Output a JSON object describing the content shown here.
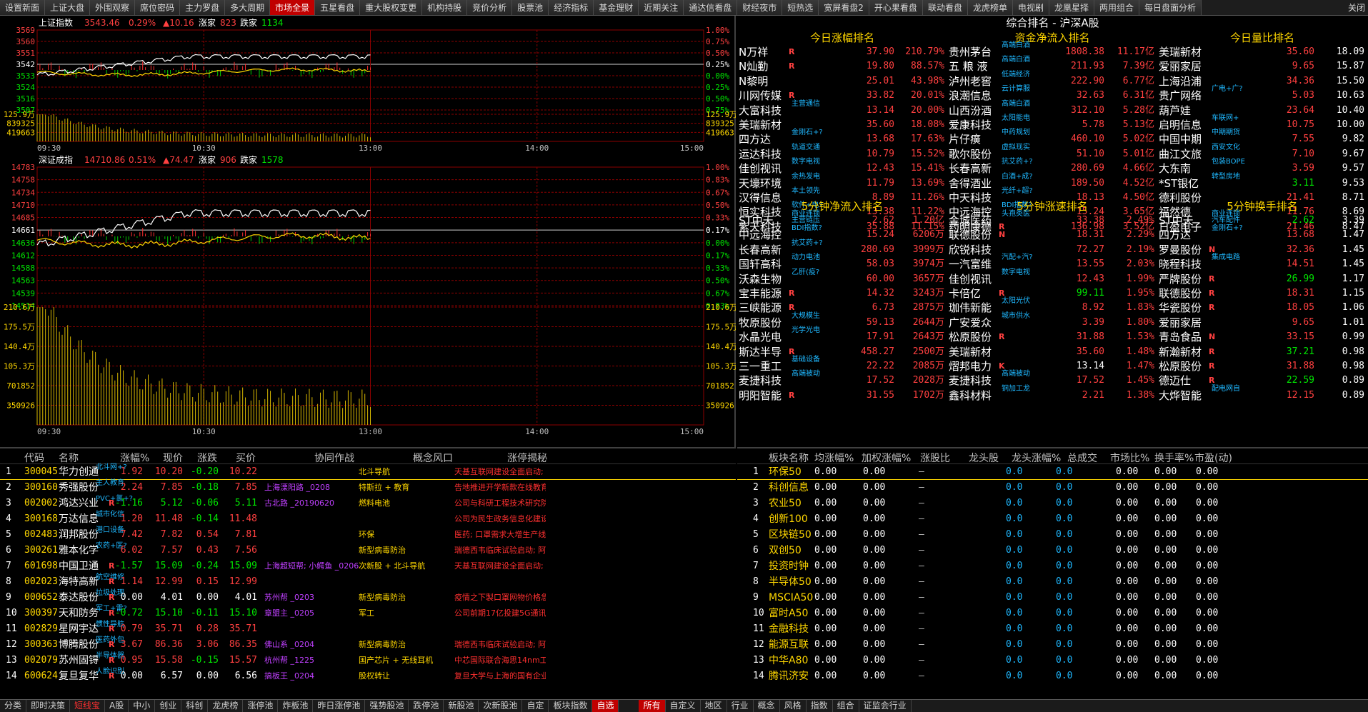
{
  "top_tabs": [
    "设置新面",
    "上证大盘",
    "外围观察",
    "席位密码",
    "主力罗盘",
    "多大周期",
    "市场全景",
    "五星看盘",
    "重大股权变更",
    "机构持股",
    "竞价分析",
    "股票池",
    "经济指标",
    "基金理财",
    "近期关注",
    "通达信看盘",
    "财经夜市",
    "短热选",
    "宽屏看盘2",
    "开心果看盘",
    "联动看盘",
    "龙虎榜单",
    "电视剧",
    "龙凰星择",
    "两用组合",
    "每日盘面分析"
  ],
  "active_tab": "市场全景",
  "close_label": "关闭",
  "sh_index": {
    "name": "上证指数",
    "price": "3543.46",
    "pct": "0.29%",
    "chg": "▲10.16",
    "up_label": "涨家",
    "up": "823",
    "down_label": "跌家",
    "down": "1134",
    "left_ticks": [
      "3569",
      "3560",
      "3551",
      "3542",
      "3533",
      "3524",
      "3516",
      "3507",
      "125.9万",
      "839325",
      "419663"
    ],
    "right_ticks": [
      "1.00%",
      "0.75%",
      "0.50%",
      "0.25%",
      "0.00%",
      "0.25%",
      "0.50%",
      "0.75%",
      "125.9万",
      "839325",
      "419663"
    ],
    "prev_close": 3533.3,
    "y_range": [
      3507,
      3569
    ]
  },
  "sz_index": {
    "name": "深证成指",
    "price": "14710.86",
    "pct": "0.51%",
    "chg": "▲74.47",
    "up_label": "涨家",
    "up": "906",
    "down_label": "跌家",
    "down": "1578",
    "left_ticks": [
      "14783",
      "14758",
      "14734",
      "14710",
      "14685",
      "14661",
      "14636",
      "14612",
      "14588",
      "14563",
      "14539",
      "14514",
      "210.6万",
      "175.5万",
      "140.4万",
      "105.3万",
      "701852",
      "350926"
    ],
    "right_ticks": [
      "1.00%",
      "0.83%",
      "0.67%",
      "0.50%",
      "0.33%",
      "0.17%",
      "0.00%",
      "0.17%",
      "0.33%",
      "0.50%",
      "0.67%",
      "0.83%",
      "210.6万",
      "175.5万",
      "140.4万",
      "105.3万",
      "701852",
      "350926"
    ],
    "prev_close": 14636.39,
    "y_range": [
      14514,
      14783
    ]
  },
  "time_labels": [
    "09:30",
    "10:30",
    "13:00",
    "14:00",
    "15:00"
  ],
  "rank_title": "综合排名 - 沪深A股",
  "rank_blocks": [
    {
      "title": "今日涨幅排名",
      "rows": [
        [
          "N万祥",
          "",
          "R",
          "37.90",
          "210.79%"
        ],
        [
          "N灿勤",
          "",
          "R",
          "19.80",
          "88.57%"
        ],
        [
          "N黎明",
          "",
          "",
          "25.01",
          "43.98%"
        ],
        [
          "川网传媒",
          "",
          "R",
          "33.82",
          "20.01%"
        ],
        [
          "大富科技",
          "主营通信",
          "",
          "13.14",
          "20.00%"
        ],
        [
          "美瑞新材",
          "",
          "",
          "35.60",
          "18.08%"
        ],
        [
          "四方达",
          "金刚石+?",
          "",
          "13.68",
          "17.63%"
        ],
        [
          "运达科技",
          "轨道交通",
          "",
          "10.79",
          "15.52%"
        ],
        [
          "佳创视讯",
          "数字电视",
          "",
          "12.43",
          "15.41%"
        ],
        [
          "天壕环境",
          "余热发电",
          "",
          "11.79",
          "13.69%"
        ],
        [
          "汉得信息",
          "本土领先",
          "",
          "8.89",
          "11.26%"
        ],
        [
          "恒实科技",
          "软件+电?",
          "",
          "13.38",
          "11.22%"
        ],
        [
          "紫天科技",
          "主营链压",
          "",
          "35.88",
          "11.15%"
        ]
      ]
    },
    {
      "title": "资金净流入排名",
      "rows": [
        [
          "贵州茅台",
          "高端白酒",
          "",
          "1808.38",
          "11.17亿"
        ],
        [
          "五 粮 液",
          "高端白酒",
          "",
          "211.93",
          "7.39亿"
        ],
        [
          "泸州老窖",
          "低端经济",
          "",
          "222.90",
          "6.77亿"
        ],
        [
          "浪潮信息",
          "云计算服",
          "",
          "32.63",
          "6.31亿"
        ],
        [
          "山西汾酒",
          "高端白酒",
          "",
          "312.10",
          "5.28亿"
        ],
        [
          "爱康科技",
          "太阳能电",
          "",
          "5.78",
          "5.13亿"
        ],
        [
          "片仔癀",
          "中药规划",
          "",
          "460.10",
          "5.02亿"
        ],
        [
          "歌尔股份",
          "虚拟现实",
          "",
          "51.10",
          "5.01亿"
        ],
        [
          "长春高新",
          "抗艾药+?",
          "",
          "280.69",
          "4.66亿"
        ],
        [
          "舍得酒业",
          "白酒+成?",
          "",
          "189.50",
          "4.52亿"
        ],
        [
          "中天科技",
          "光纤+超?",
          "",
          "18.13",
          "4.50亿"
        ],
        [
          "中远海控",
          "BDI指数?",
          "",
          "15.24",
          "3.65亿"
        ],
        [
          "药明康德",
          "",
          "R",
          "136.98",
          "3.52亿"
        ]
      ]
    },
    {
      "title": "今日量比排名",
      "rows": [
        [
          "美瑞新材",
          "",
          "",
          "35.60",
          "18.09"
        ],
        [
          "爱丽家居",
          "",
          "",
          "9.65",
          "15.87"
        ],
        [
          "上海沿浦",
          "",
          "",
          "34.36",
          "15.50"
        ],
        [
          "贵广网络",
          "广电+广?",
          "",
          "5.03",
          "10.63"
        ],
        [
          "葫芦娃",
          "",
          "",
          "23.64",
          "10.40"
        ],
        [
          "启明信息",
          "车联网+",
          "",
          "10.75",
          "10.00"
        ],
        [
          "中国中期",
          "中期期货",
          "",
          "7.55",
          "9.82"
        ],
        [
          "曲江文旅",
          "西安文化",
          "",
          "7.10",
          "9.67"
        ],
        [
          "大东南",
          "包装BOPE",
          "",
          "3.59",
          "9.57"
        ],
        [
          "*ST银亿",
          "转型房地",
          "",
          "3.11",
          "9.53"
        ],
        [
          "德利股份",
          "",
          "",
          "21.41",
          "8.71"
        ],
        [
          "福然德",
          "",
          "",
          "11.76",
          "8.69"
        ],
        [
          "日盈电子",
          "汽车配件",
          "",
          "21.46",
          "8.47"
        ]
      ]
    },
    {
      "title": "5分钟净流入排名",
      "rows": [
        [
          "ST中天",
          "商业连锁",
          "",
          "2.62",
          "1.20亿"
        ],
        [
          "中远海控",
          "BDI指数?",
          "",
          "15.24",
          "6206万"
        ],
        [
          "长春高新",
          "抗艾药+?",
          "",
          "280.69",
          "3999万"
        ],
        [
          "国轩高科",
          "动力电池",
          "",
          "58.03",
          "3974万"
        ],
        [
          "沃森生物",
          "乙肝(疫?",
          "",
          "60.00",
          "3657万"
        ],
        [
          "宝丰能源",
          "",
          "R",
          "14.32",
          "3243万"
        ],
        [
          "三峡能源",
          "",
          "R",
          "6.73",
          "2875万"
        ],
        [
          "牧原股份",
          "大规模生",
          "",
          "59.13",
          "2644万"
        ],
        [
          "水晶光电",
          "光学光电",
          "",
          "17.91",
          "2643万"
        ],
        [
          "斯达半导",
          "",
          "R",
          "458.27",
          "2500万"
        ],
        [
          "三一重工",
          "基础设备",
          "",
          "22.22",
          "2085万"
        ],
        [
          "麦捷科技",
          "高端被动",
          "",
          "17.52",
          "2028万"
        ],
        [
          "明阳智能",
          "",
          "R",
          "31.55",
          "1702万"
        ]
      ]
    },
    {
      "title": "5分钟涨速排名",
      "rows": [
        [
          "金城医药",
          "头孢类医",
          "",
          "33.38",
          "2.49%"
        ],
        [
          "联德股份",
          "",
          "N",
          "18.31",
          "2.29%"
        ],
        [
          "欣锐科技",
          "",
          "",
          "72.27",
          "2.19%"
        ],
        [
          "一汽富维",
          "汽配+汽?",
          "",
          "13.55",
          "2.03%"
        ],
        [
          "佳创视讯",
          "数字电视",
          "",
          "12.43",
          "1.99%"
        ],
        [
          "卡倍亿",
          "",
          "R",
          "99.11",
          "1.95%"
        ],
        [
          "珈伟新能",
          "太阳光伏",
          "",
          "8.92",
          "1.83%"
        ],
        [
          "广安爱众",
          "城市供水",
          "",
          "3.39",
          "1.80%"
        ],
        [
          "松原股份",
          "",
          "R",
          "31.88",
          "1.53%"
        ],
        [
          "美瑞新材",
          "",
          "",
          "35.60",
          "1.48%"
        ],
        [
          "熠邦电力",
          "",
          "K",
          "13.14",
          "1.47%"
        ],
        [
          "麦捷科技",
          "高端被动",
          "",
          "17.52",
          "1.45%"
        ],
        [
          "鑫科材料",
          "铜加工龙",
          "",
          "2.21",
          "1.38%"
        ]
      ]
    },
    {
      "title": "5分钟换手排名",
      "rows": [
        [
          "ST中天",
          "商业连锁",
          "",
          "2.62",
          "3.39"
        ],
        [
          "四方达",
          "金刚石+?",
          "",
          "13.68",
          "1.47"
        ],
        [
          "罗曼股份",
          "",
          "N",
          "32.36",
          "1.45"
        ],
        [
          "晓程科技",
          "集成电路",
          "",
          "14.51",
          "1.45"
        ],
        [
          "严牌股份",
          "",
          "R",
          "26.99",
          "1.17"
        ],
        [
          "联德股份",
          "",
          "R",
          "18.31",
          "1.15"
        ],
        [
          "华瓷股份",
          "",
          "R",
          "18.05",
          "1.06"
        ],
        [
          "爱丽家居",
          "",
          "",
          "9.65",
          "1.01"
        ],
        [
          "青岛食品",
          "",
          "N",
          "33.15",
          "0.99"
        ],
        [
          "新瀚新材",
          "",
          "R",
          "37.21",
          "0.98"
        ],
        [
          "松原股份",
          "",
          "R",
          "31.88",
          "0.98"
        ],
        [
          "德迈仕",
          "",
          "R",
          "22.59",
          "0.89"
        ],
        [
          "大烨智能",
          "配电网自",
          "",
          "12.15",
          "0.89"
        ]
      ]
    }
  ],
  "stock_table": {
    "headers": [
      "代码",
      "名称",
      "涨幅%",
      "现价",
      "涨跌",
      "买价",
      "协同作战",
      "概念风口",
      "涨停揭秘"
    ],
    "rows": [
      [
        "1",
        "300045",
        "华力创通",
        "北斗网+?",
        "",
        "1.92",
        "10.20",
        "-0.20",
        "10.22",
        "",
        "北斗导航",
        "天基互联网建设全面启动; 公"
      ],
      [
        "2",
        "300160",
        "秀强股份",
        "主人教育",
        "",
        "2.24",
        "7.85",
        "-0.18",
        "7.85",
        "上海溧阳路 _0208",
        "特斯拉 + 教育",
        "告地推进开学新款在线教育"
      ],
      [
        "3",
        "002002",
        "鸿达兴业",
        "PVC+氯+?",
        "R",
        "-1.16",
        "5.12",
        "-0.06",
        "5.11",
        "古北路 _20190620",
        "燃料电池",
        "公司与科研工程技术研究院合"
      ],
      [
        "4",
        "300168",
        "万达信息",
        "城市化信",
        "",
        "1.20",
        "11.48",
        "-0.14",
        "11.48",
        "",
        "",
        "公司为民生政务信息化建设龙"
      ],
      [
        "5",
        "002483",
        "润邦股份",
        "港口设备",
        "",
        "7.42",
        "7.82",
        "0.54",
        "7.81",
        "",
        "环保",
        "医药; 口罩需求大增生产线"
      ],
      [
        "6",
        "300261",
        "雅本化学",
        "农药+医?",
        "",
        "6.02",
        "7.57",
        "0.43",
        "7.56",
        "",
        "新型病毒防治",
        "瑞德西韦临床试验启动; 阿比"
      ],
      [
        "7",
        "601698",
        "中国卫通",
        "",
        "R",
        "-1.57",
        "15.09",
        "-0.24",
        "15.09",
        "上海超短帮; 小鳄鱼 _0206",
        "次新股 + 北斗导航",
        "天基互联网建设全面启动; 公"
      ],
      [
        "8",
        "002023",
        "海特高新",
        "航空维修",
        "R",
        "1.14",
        "12.99",
        "0.15",
        "12.99",
        "",
        "",
        ""
      ],
      [
        "9",
        "000652",
        "泰达股份",
        "垃圾处理",
        "R",
        "0.00",
        "4.01",
        "0.00",
        "4.01",
        "苏州帮 _0203",
        "新型病毒防治",
        "疫情之下製口罩网物价格急"
      ],
      [
        "10",
        "300397",
        "天和防务",
        "军工+雷?",
        "R",
        "-0.72",
        "15.10",
        "-0.11",
        "15.10",
        "章盟主 _0205",
        "军工",
        "公司前期17亿投建5G通讯产"
      ],
      [
        "11",
        "002829",
        "星网宇达",
        "惯性导航",
        "R",
        "0.79",
        "35.71",
        "0.28",
        "35.71",
        "",
        "",
        ""
      ],
      [
        "12",
        "300363",
        "博腾股份",
        "医药外包",
        "R",
        "3.67",
        "86.36",
        "3.06",
        "86.35",
        "佛山系 _0204",
        "新型病毒防治",
        "瑞德西韦临床试验启动; 阿比"
      ],
      [
        "13",
        "002079",
        "苏州固锝",
        "半导体器",
        "R",
        "0.95",
        "15.58",
        "-0.15",
        "15.57",
        "杭州帮 _1225",
        "国产芯片 + 无线耳机",
        "中芯国际联合海思14nm工艺"
      ],
      [
        "14",
        "600624",
        "复旦复华",
        "人脸识别",
        "R",
        "0.00",
        "6.57",
        "0.00",
        "6.56",
        "搞板王 _0204",
        "股权转让",
        "复旦大学与上海的国有企业"
      ]
    ]
  },
  "sector_table": {
    "headers": [
      "板块名称",
      "均涨幅%",
      "加权涨幅%",
      "涨股比",
      "龙头股",
      "龙头涨幅%",
      "总成交",
      "市场比%",
      "换手率%",
      "市盈(动)"
    ],
    "rows": [
      [
        "1",
        "环保50"
      ],
      [
        "2",
        "科创信息"
      ],
      [
        "3",
        "农业50"
      ],
      [
        "4",
        "创新100"
      ],
      [
        "5",
        "区块链50"
      ],
      [
        "6",
        "双创50"
      ],
      [
        "7",
        "投资时钟"
      ],
      [
        "8",
        "半导体50"
      ],
      [
        "9",
        "MSCIA50"
      ],
      [
        "10",
        "富时A50"
      ],
      [
        "11",
        "金融科技"
      ],
      [
        "12",
        "能源互联"
      ],
      [
        "13",
        "中华A80"
      ],
      [
        "14",
        "腾讯济安"
      ]
    ],
    "zero": "0.00",
    "dash": "–",
    "blue_zero": "0.0"
  },
  "bottom_tabs_left": [
    "分类",
    "即时决策",
    "短线宝",
    "A股",
    "中小",
    "创业",
    "科创",
    "龙虎榜",
    "涨停池",
    "炸板池",
    "昨日涨停池",
    "强势股池",
    "跌停池",
    "新股池",
    "次新股池",
    "自定",
    "板块指数",
    "自选"
  ],
  "bottom_tabs_right": [
    "所有",
    "自定义",
    "地区",
    "行业",
    "概念",
    "风格",
    "指数",
    "组合",
    "证监会行业"
  ],
  "colors": {
    "up": "#ff4040",
    "down": "#00e600",
    "accent": "#c00000",
    "cyan": "#1fb8ff",
    "yellow": "#ffd700"
  }
}
